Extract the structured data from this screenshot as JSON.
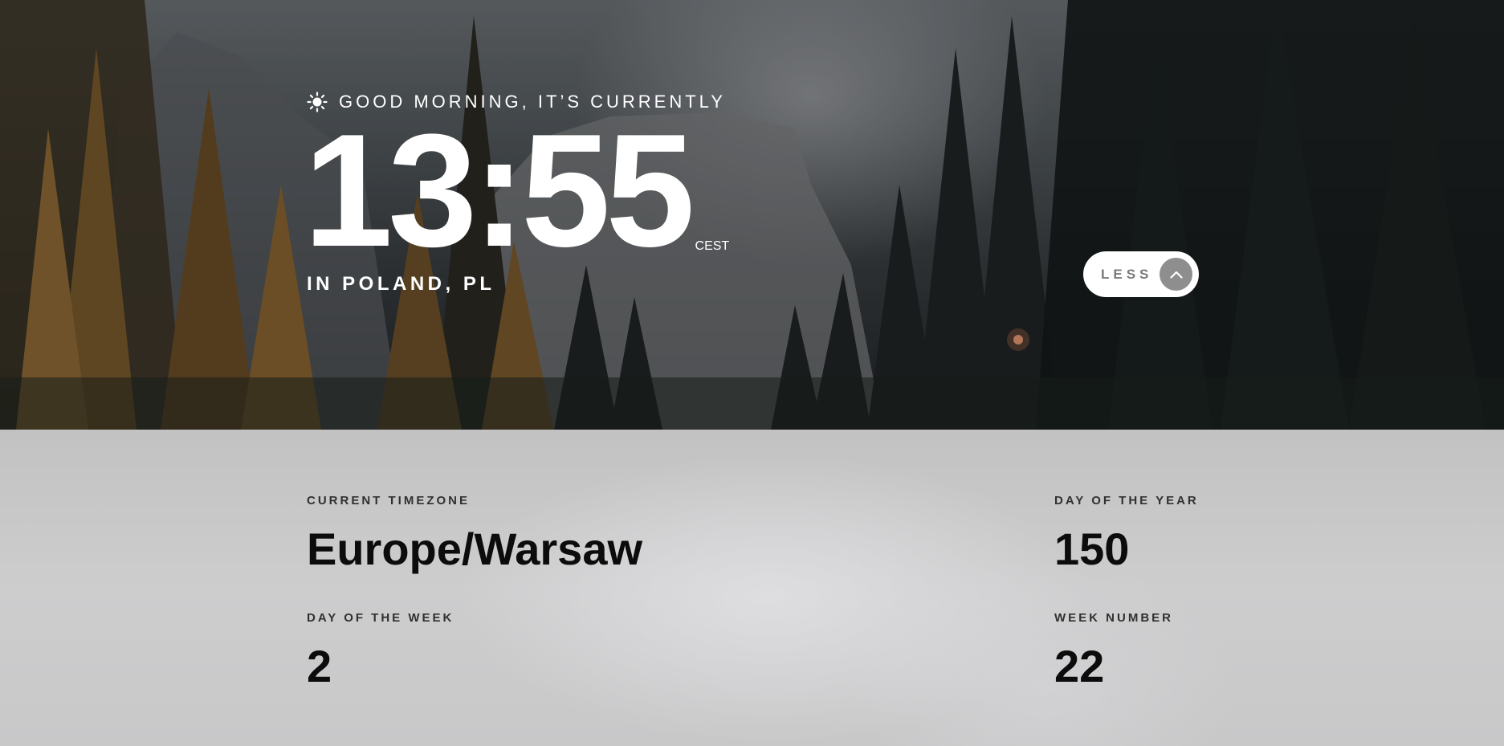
{
  "hero": {
    "greeting": "GOOD MORNING, IT’S CURRENTLY",
    "greeting_icon": "sun-icon",
    "time": "13:55",
    "timezone_abbr": "CEST",
    "location": "IN POLAND, PL"
  },
  "toggle": {
    "label": "LESS",
    "icon": "chevron-up-icon"
  },
  "details": {
    "timezone": {
      "label": "CURRENT TIMEZONE",
      "value": "Europe/Warsaw"
    },
    "day_of_year": {
      "label": "DAY OF THE YEAR",
      "value": "150"
    },
    "day_of_week": {
      "label": "DAY OF THE WEEK",
      "value": "2"
    },
    "week_number": {
      "label": "WEEK NUMBER",
      "value": "22"
    }
  },
  "colors": {
    "hero_text": "#ffffff",
    "toggle_bg": "#ffffff",
    "toggle_icon_bg": "#8e8e8e",
    "panel_bg": "#c8c8c9",
    "panel_label": "#303030",
    "panel_value": "#0c0c0c"
  }
}
